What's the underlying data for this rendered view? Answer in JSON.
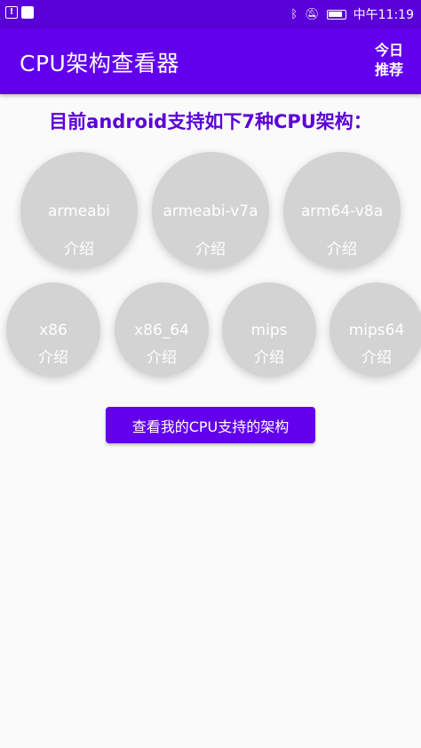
{
  "status_bar": {
    "time": "中午11:19",
    "left_icons": [
      "alert-icon",
      "image-icon"
    ],
    "right_icons": [
      "bluetooth-icon",
      "mute-icon",
      "battery-icon"
    ]
  },
  "app_bar": {
    "title": "CPU架构查看器",
    "action_label_line1": "今日",
    "action_label_line2": "推荐"
  },
  "heading": "目前android支持如下7种CPU架构：",
  "architectures": [
    {
      "name": "armeabi",
      "intro": "介绍"
    },
    {
      "name": "armeabi-v7a",
      "intro": "介绍"
    },
    {
      "name": "arm64-v8a",
      "intro": "介绍"
    },
    {
      "name": "x86",
      "intro": "介绍"
    },
    {
      "name": "x86_64",
      "intro": "介绍"
    },
    {
      "name": "mips",
      "intro": "介绍"
    },
    {
      "name": "mips64",
      "intro": "介绍"
    }
  ],
  "check_button_label": "查看我的CPU支持的架构",
  "colors": {
    "primary": "#6200ee",
    "status_bar": "#5a00d8",
    "circle": "#d3d3d3",
    "background": "#fafafa"
  }
}
